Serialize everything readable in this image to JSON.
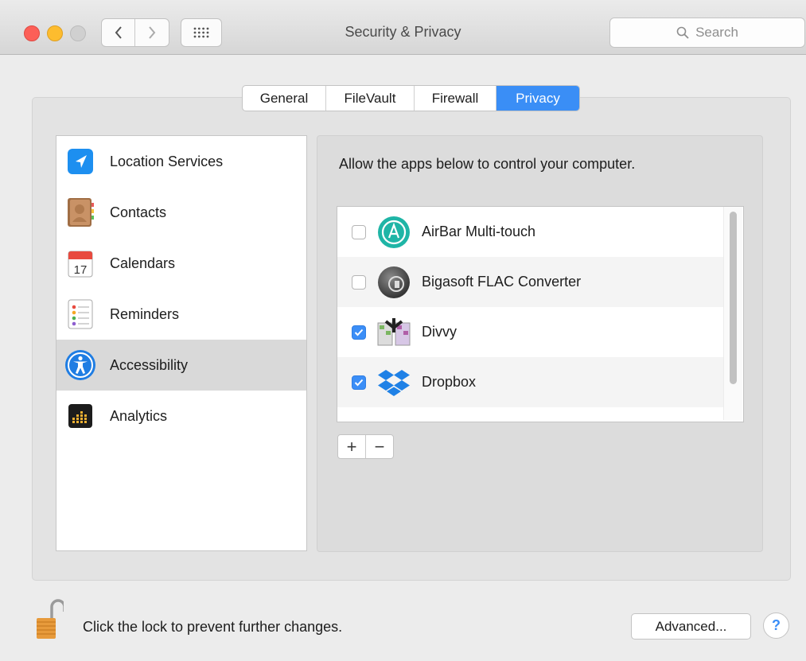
{
  "window": {
    "title": "Security & Privacy",
    "search_placeholder": "Search"
  },
  "tabs": [
    {
      "label": "General",
      "selected": false
    },
    {
      "label": "FileVault",
      "selected": false
    },
    {
      "label": "Firewall",
      "selected": false
    },
    {
      "label": "Privacy",
      "selected": true
    }
  ],
  "categories": [
    {
      "label": "Location Services",
      "icon": "location-services-icon",
      "selected": false
    },
    {
      "label": "Contacts",
      "icon": "contacts-icon",
      "selected": false
    },
    {
      "label": "Calendars",
      "icon": "calendars-icon",
      "selected": false,
      "icon_text": "17"
    },
    {
      "label": "Reminders",
      "icon": "reminders-icon",
      "selected": false
    },
    {
      "label": "Accessibility",
      "icon": "accessibility-icon",
      "selected": true
    },
    {
      "label": "Analytics",
      "icon": "analytics-icon",
      "selected": false
    }
  ],
  "main": {
    "description": "Allow the apps below to control your computer.",
    "apps": [
      {
        "name": "AirBar Multi-touch",
        "checked": false,
        "icon": "airbar-icon"
      },
      {
        "name": "Bigasoft FLAC Converter",
        "checked": false,
        "icon": "bigasoft-icon"
      },
      {
        "name": "Divvy",
        "checked": true,
        "icon": "divvy-icon"
      },
      {
        "name": "Dropbox",
        "checked": true,
        "icon": "dropbox-icon"
      }
    ],
    "add_label": "+",
    "remove_label": "−"
  },
  "footer": {
    "lock_text": "Click the lock to prevent further changes.",
    "advanced_label": "Advanced...",
    "help_label": "?"
  },
  "colors": {
    "accent": "#3a8ef6",
    "close": "#fc5f57",
    "minimize": "#fdbc2e"
  }
}
